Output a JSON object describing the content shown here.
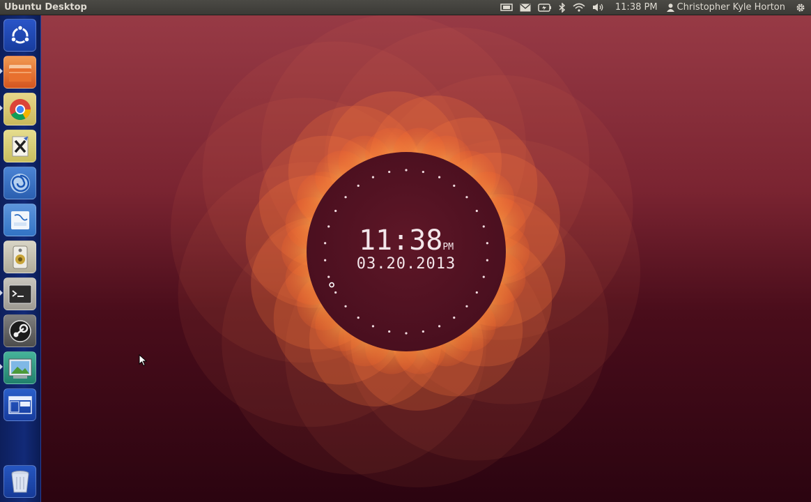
{
  "panel": {
    "title": "Ubuntu Desktop",
    "time": "11:38 PM",
    "user": "Christopher Kyle Horton",
    "indicators": [
      "monitor-icon",
      "mail-icon",
      "battery-icon",
      "bluetooth-icon",
      "wifi-icon",
      "volume-icon"
    ]
  },
  "launcher": {
    "items": [
      "dash-home",
      "files",
      "chrome",
      "xournal",
      "app-swirl",
      "mysql-workbench",
      "speaker-app",
      "terminal",
      "steam",
      "image-viewer",
      "workspace-switcher"
    ],
    "trash": "trash"
  },
  "clock_widget": {
    "time": "11:38",
    "ampm": "PM",
    "date": "03.20.2013"
  },
  "colors": {
    "panel": "#3c3b37",
    "launcher": "#122a78",
    "accent": "#e95420"
  }
}
